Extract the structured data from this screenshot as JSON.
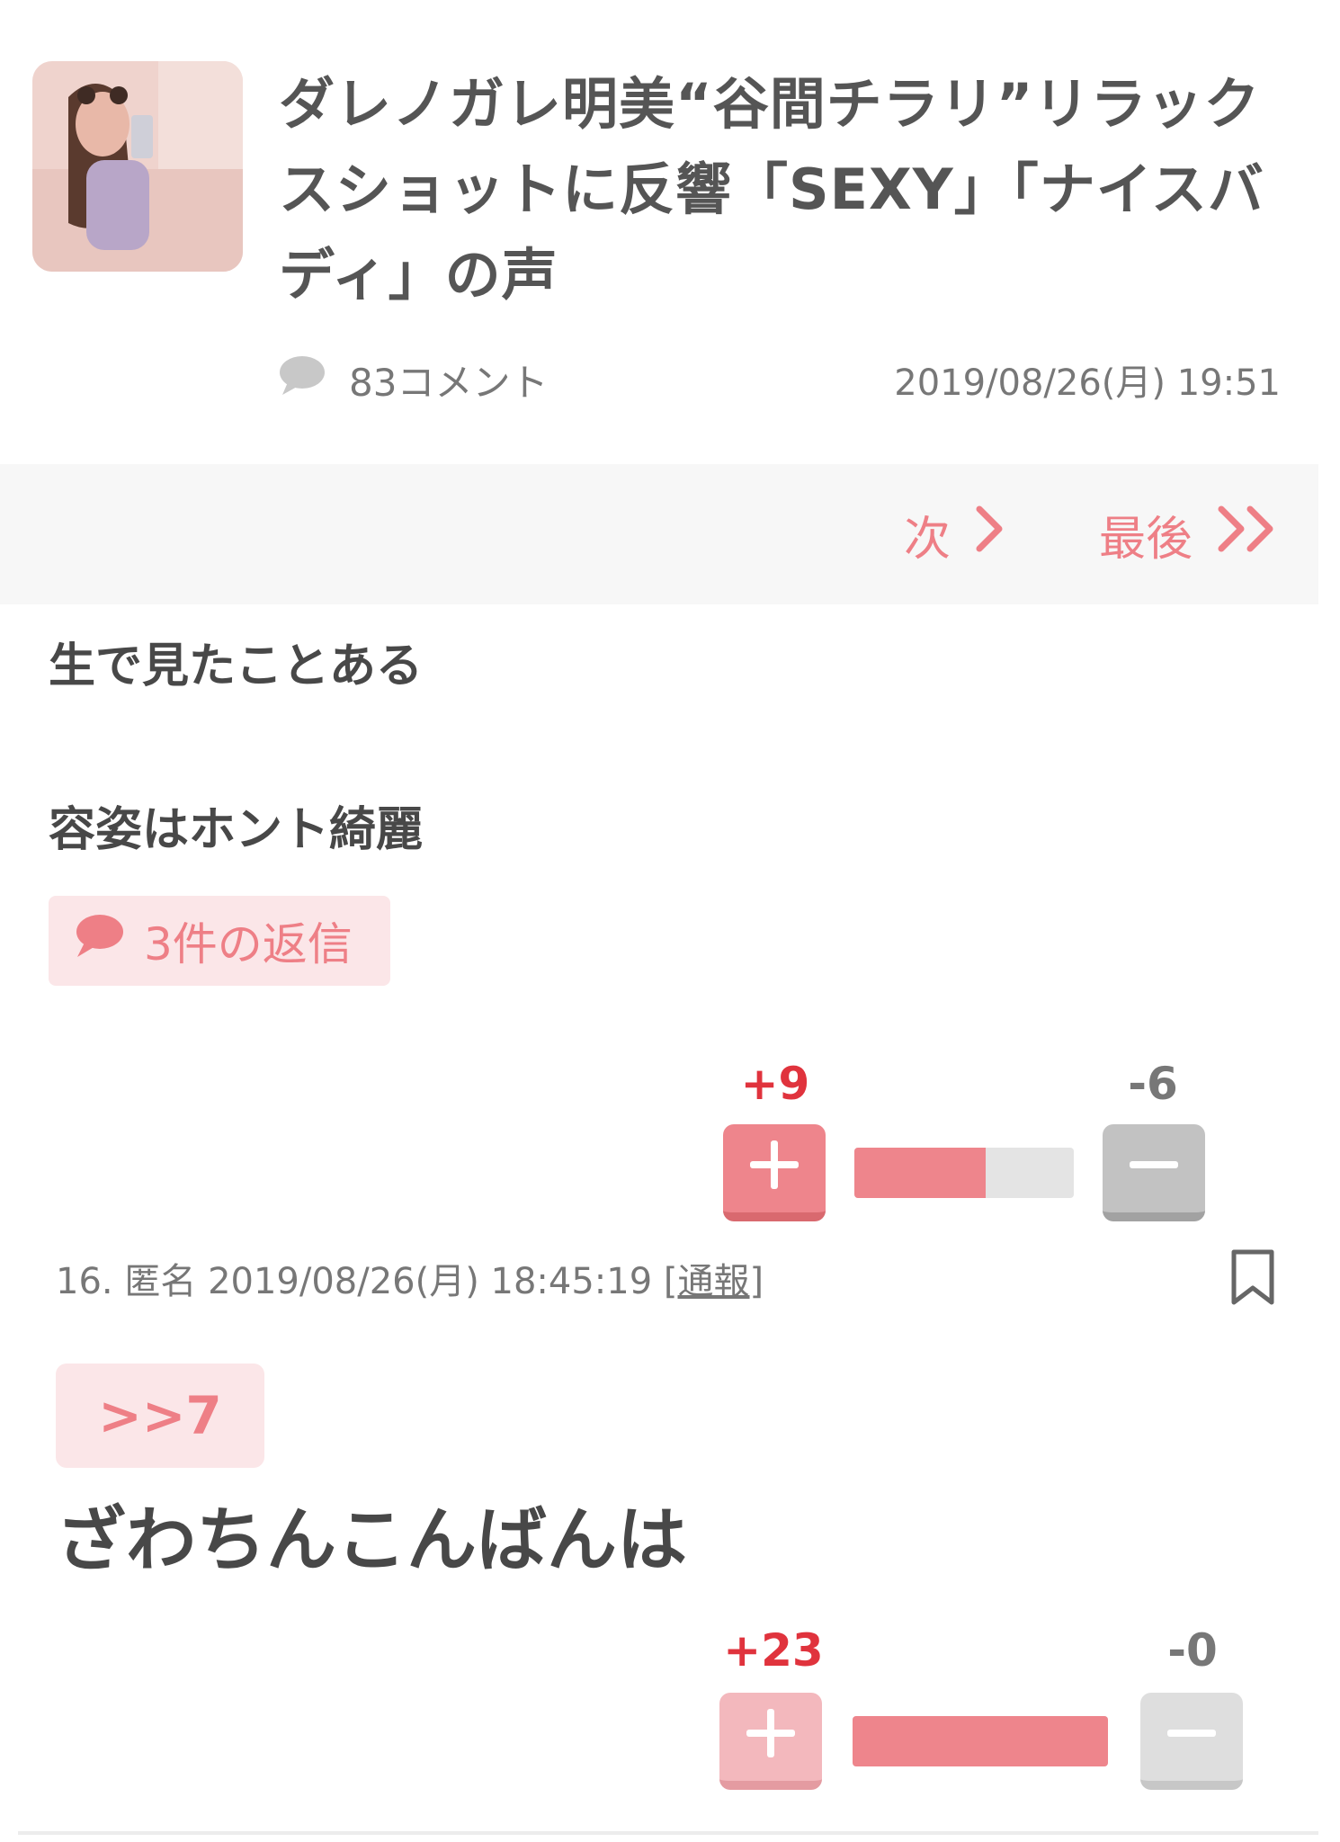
{
  "article": {
    "title": "ダレノガレ明美“谷間チラリ”リラックスショットに反響「SEXY」「ナイスバディ」の声",
    "comments": "83コメント",
    "date": "2019/08/26(月) 19:51"
  },
  "pager": {
    "next": "次",
    "last": "最後"
  },
  "comment15": {
    "line1": "生で見たことある",
    "line2": "容姿はホント綺麗",
    "replies": "3件の返信",
    "plus": "+9",
    "minus": "-6",
    "plus_ratio": 0.6
  },
  "comment16": {
    "number": "16.",
    "author": "匿名",
    "datetime": "2019/08/26(月) 18:45:19",
    "report": "通報",
    "anchor": ">>7",
    "text": "ざわちんこんばんは",
    "plus": "+23",
    "minus": "-0",
    "plus_ratio": 1.0
  },
  "colors": {
    "accent": "#ee7f86",
    "plus_count": "#e0333d"
  }
}
